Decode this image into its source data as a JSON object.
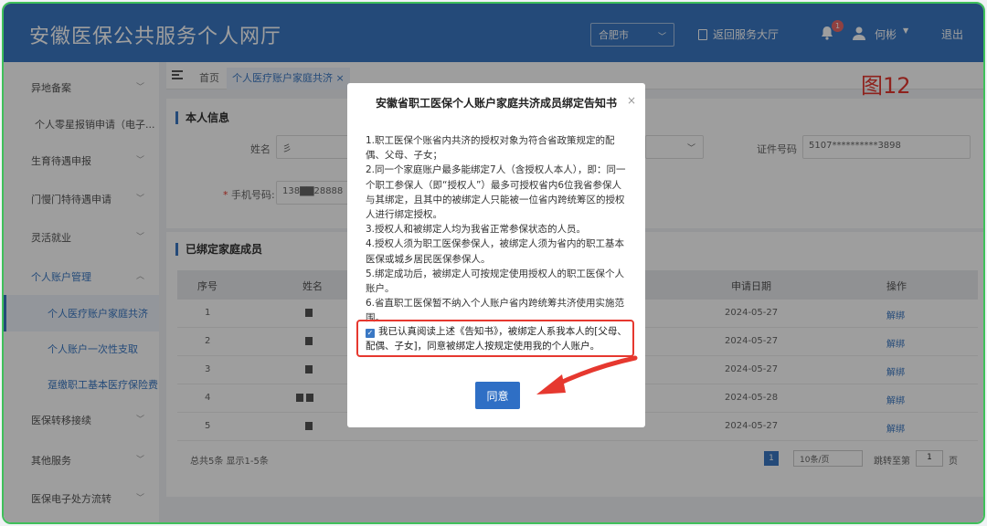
{
  "header": {
    "title": "安徽医保公共服务个人网厅",
    "city": "合肥市",
    "back_label": "返回服务大厅",
    "notification_count": "1",
    "username": "何彬",
    "logout": "退出"
  },
  "sidebar": {
    "items": [
      {
        "label": "异地备案"
      },
      {
        "label": "个人零星报销申请（电子..."
      },
      {
        "label": "生育待遇申报"
      },
      {
        "label": "门慢门特待遇申请"
      },
      {
        "label": "灵活就业"
      },
      {
        "label": "个人账户管理"
      },
      {
        "label": "个人医疗账户家庭共济"
      },
      {
        "label": "个人账户一次性支取"
      },
      {
        "label": "趸缴职工基本医疗保险费"
      },
      {
        "label": "医保转移接续"
      },
      {
        "label": "其他服务"
      },
      {
        "label": "医保电子处方流转"
      }
    ]
  },
  "tabs": {
    "home": "首页",
    "current": "个人医疗账户家庭共济"
  },
  "annotation": "图12",
  "personal_info": {
    "title": "本人信息",
    "name_label": "姓名",
    "name_value": "彡",
    "phone_label": "手机号码:",
    "phone_value": "138▇▇28888",
    "id_label": "证件号码",
    "id_value": "5107**********3898"
  },
  "bound_members": {
    "title": "已绑定家庭成员",
    "columns": [
      "序号",
      "姓名",
      "申请日期",
      "操作"
    ],
    "rows": [
      {
        "no": "1",
        "date": "2024-05-27",
        "action": "解绑"
      },
      {
        "no": "2",
        "date": "2024-05-27",
        "action": "解绑"
      },
      {
        "no": "3",
        "date": "2024-05-27",
        "action": "解绑"
      },
      {
        "no": "4",
        "date": "2024-05-28",
        "action": "解绑"
      },
      {
        "no": "5",
        "date": "2024-05-27",
        "action": "解绑"
      }
    ],
    "summary": "总共5条 显示1-5条",
    "page": "1",
    "page_size": "10条/页",
    "jump_label": "跳转至第",
    "jump_value": "1",
    "page_unit": "页"
  },
  "modal": {
    "title": "安徽省职工医保个人账户家庭共济成员绑定告知书",
    "paragraphs": [
      "1.职工医保个账省内共济的授权对象为符合省政策规定的配偶、父母、子女；",
      "2.同一个家庭账户最多能绑定7人（含授权人本人），即：同一个职工参保人（即“授权人”）最多可授权省内6位我省参保人与其绑定，且其中的被绑定人只能被一位省内跨统筹区的授权人进行绑定授权。",
      "3.授权人和被绑定人均为我省正常参保状态的人员。",
      "4.授权人须为职工医保参保人，被绑定人须为省内的职工基本医保或城乡居民医保参保人。",
      "5.绑定成功后，被绑定人可按规定使用授权人的职工医保个人账户。",
      "6.省直职工医保暂不纳入个人账户省内跨统筹共济使用实施范围。"
    ],
    "agreement": "我已认真阅读上述《告知书》，被绑定人系我本人的[父母、配偶、子女]，同意被绑定人按规定使用我的个人账户。",
    "agree_button": "同意"
  }
}
